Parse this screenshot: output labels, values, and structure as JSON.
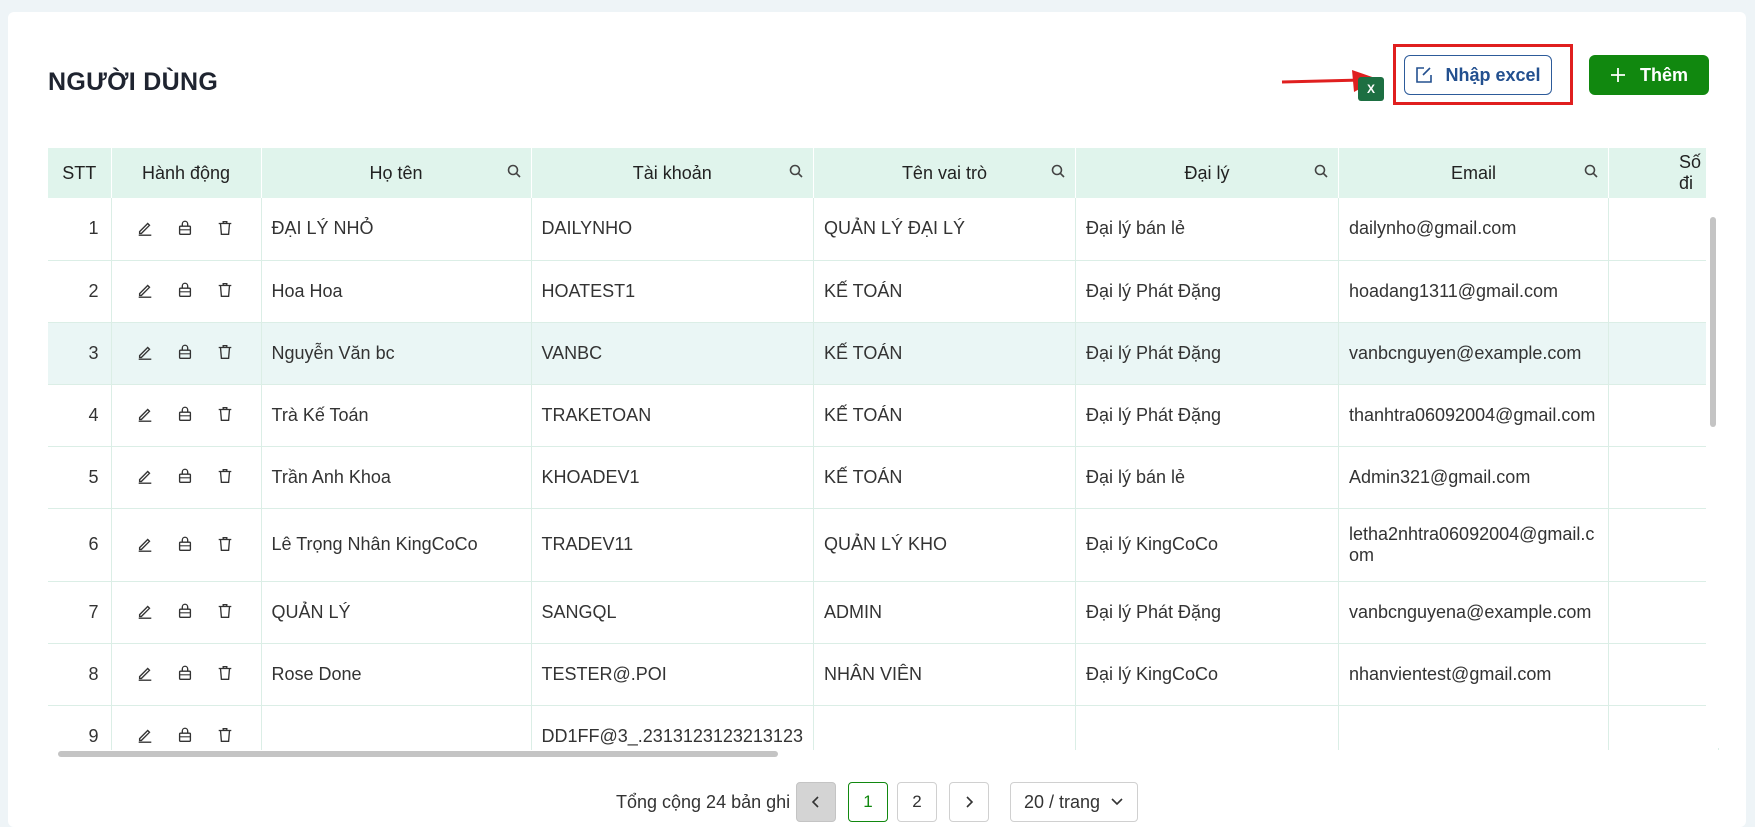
{
  "page": {
    "title": "NGƯỜI DÙNG"
  },
  "toolbar": {
    "import_label": "Nhập excel",
    "add_label": "Thêm",
    "excel_icon_text": "X"
  },
  "table": {
    "headers": [
      "STT",
      "Hành động",
      "Họ tên",
      "Tài khoản",
      "Tên vai trò",
      "Đại lý",
      "Email",
      "Số đi"
    ],
    "rows": [
      {
        "stt": "1",
        "name": "ĐẠI LÝ NHỎ",
        "account": "DAILYNHO",
        "role": "QUẢN LÝ ĐẠI LÝ",
        "agency": "Đại lý bán lẻ",
        "email": "dailynho@gmail.com"
      },
      {
        "stt": "2",
        "name": "Hoa Hoa",
        "account": "HOATEST1",
        "role": "KẾ TOÁN",
        "agency": "Đại lý Phát Đặng",
        "email": "hoadang1311@gmail.com"
      },
      {
        "stt": "3",
        "name": "Nguyễn Văn bc",
        "account": "VANBC",
        "role": "KẾ TOÁN",
        "agency": "Đại lý Phát Đặng",
        "email": "vanbcnguyen@example.com"
      },
      {
        "stt": "4",
        "name": "Trà Kế Toán",
        "account": "TRAKETOAN",
        "role": "KẾ TOÁN",
        "agency": "Đại lý Phát Đặng",
        "email": "thanhtra06092004@gmail.com"
      },
      {
        "stt": "5",
        "name": "Trần Anh Khoa",
        "account": "KHOADEV1",
        "role": "KẾ TOÁN",
        "agency": "Đại lý bán lẻ",
        "email": "Admin321@gmail.com"
      },
      {
        "stt": "6",
        "name": "Lê Trọng Nhân KingCoCo",
        "account": "TRADEV11",
        "role": "QUẢN LÝ KHO",
        "agency": "Đại lý KingCoCo",
        "email": "letha2nhtra06092004@gmail.com"
      },
      {
        "stt": "7",
        "name": "QUẢN LÝ",
        "account": "SANGQL",
        "role": "ADMIN",
        "agency": "Đại lý Phát Đặng",
        "email": "vanbcnguyena@example.com"
      },
      {
        "stt": "8",
        "name": "Rose Done",
        "account": "TESTER@.POI",
        "role": "NHÂN VIÊN",
        "agency": "Đại lý KingCoCo",
        "email": "nhanvientest@gmail.com"
      },
      {
        "stt": "9",
        "name": "",
        "account": "DD1FF@3_.2313123123213123",
        "role": "",
        "agency": "",
        "email": ""
      }
    ]
  },
  "pagination": {
    "total_text": "Tổng cộng 24 bản ghi",
    "pages": [
      "1",
      "2"
    ],
    "current": "1",
    "page_size": "20 / trang"
  },
  "colors": {
    "accent": "#11880f",
    "header_bg": "#e0f4ec",
    "highlight": "#e01f1f",
    "link_blue": "#23508f"
  },
  "icons": [
    "edit-icon",
    "lock-icon",
    "trash-icon",
    "search-icon",
    "excel-icon",
    "plus-icon",
    "chevron-left-icon",
    "chevron-right-icon",
    "chevron-down-icon"
  ]
}
